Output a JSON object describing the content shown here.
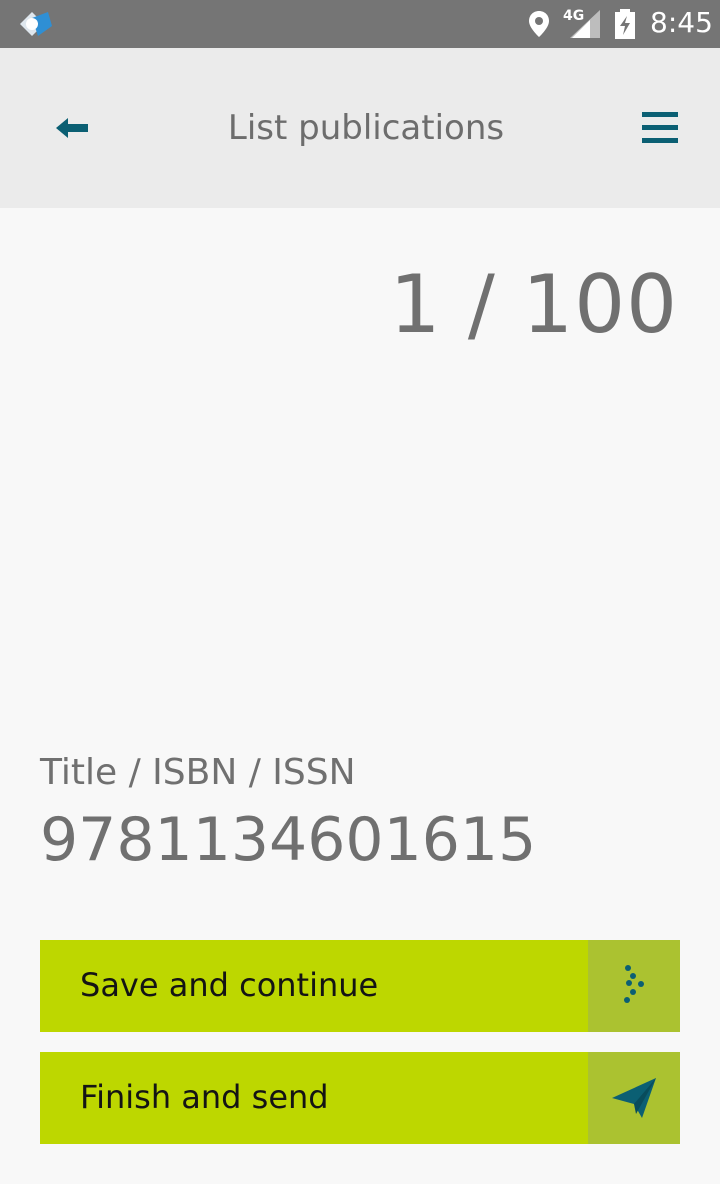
{
  "status_bar": {
    "network": "4G",
    "time": "8:45",
    "icons": [
      "app-icon",
      "location-icon",
      "signal-icon",
      "battery-icon"
    ]
  },
  "app_bar": {
    "title": "List publications",
    "icons": [
      "back-arrow-icon",
      "hamburger-menu-icon"
    ]
  },
  "main": {
    "counter": "1 / 100",
    "field_label": "Title / ISBN / ISSN",
    "field_value": "9781134601615"
  },
  "actions": {
    "save_label": "Save and continue",
    "save_icon": "dots-arrow-icon",
    "finish_label": "Finish and send",
    "finish_icon": "paper-plane-icon"
  },
  "colors": {
    "accent": "#bdd700",
    "accent_dark": "#abc230",
    "icon_teal": "#0b5f73",
    "status_bar": "#757575",
    "app_bar": "#ebebeb"
  }
}
